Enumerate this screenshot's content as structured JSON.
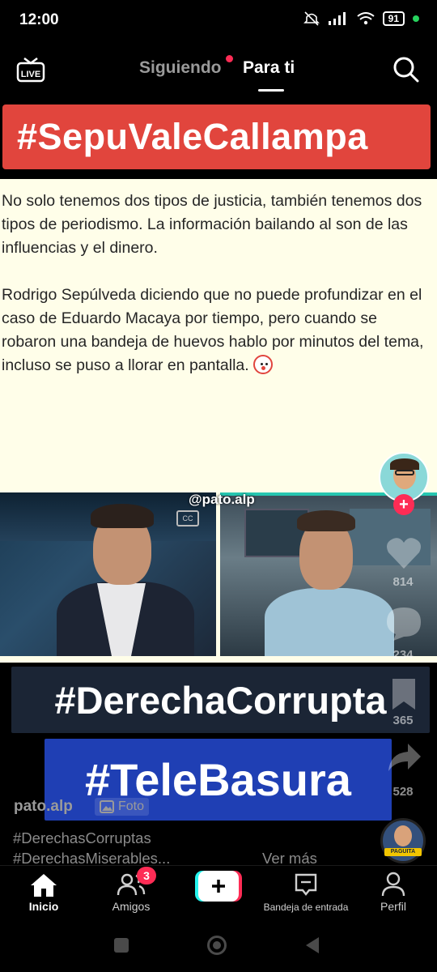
{
  "status_bar": {
    "time": "12:00",
    "battery": "91"
  },
  "top_nav": {
    "live": "LIVE",
    "following": "Siguiendo",
    "for_you": "Para ti"
  },
  "post": {
    "hashtag_top": "#SepuValeCallampa",
    "paragraph1": "No solo tenemos dos tipos de justicia, también tenemos dos tipos de periodismo. La información bailando al son de las influencias y el dinero.",
    "paragraph2": "Rodrigo Sepúlveda diciendo que no puede profundizar en el caso de Eduardo Macaya por tiempo, pero cuando se robaron una bandeja de huevos hablo por minutos del tema, incluso se puso a llorar en pantalla.",
    "watermark": "@pato.alp",
    "cc": "CC"
  },
  "overlay": {
    "hashtag_mid": "#DerechaCorrupta",
    "hashtag_blue": "#TeleBasura"
  },
  "rail": {
    "likes": "814",
    "comments": "234",
    "saves": "365",
    "shares": "528"
  },
  "caption": {
    "author": "pato.alp",
    "photo_badge": "Foto",
    "line1": "#DerechasCorruptas",
    "line2": "#DerechasMiserables...",
    "see_more": "Ver más"
  },
  "disc_label": "PAGUITA",
  "bottom_nav": {
    "home": "Inicio",
    "friends": "Amigos",
    "friends_badge": "3",
    "inbox": "Bandeja de entrada",
    "profile": "Perfil"
  },
  "colors": {
    "accent": "#fe2c55",
    "hashtag_red": "#e1453d",
    "hashtag_blue": "#1f3fb4",
    "post_bg": "#fffee9"
  }
}
